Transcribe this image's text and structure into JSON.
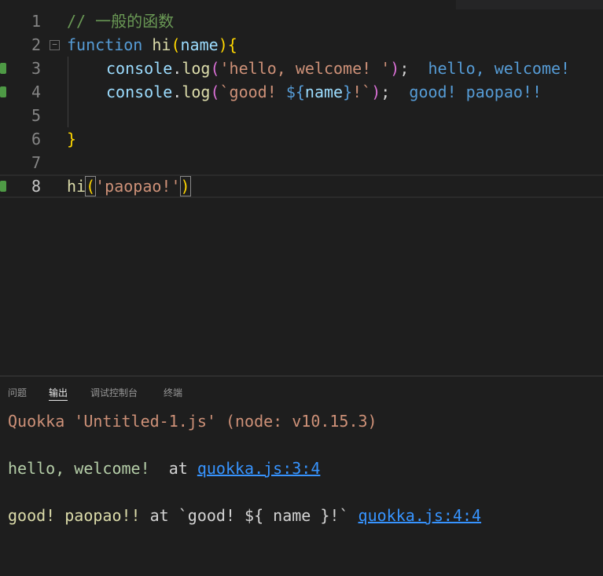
{
  "editor": {
    "lines": [
      {
        "num": "1",
        "comment": "// 一般的函数"
      },
      {
        "num": "2",
        "kw": "function",
        "fn": "hi",
        "open": "(",
        "param": "name",
        "close": ")",
        "brace": "{"
      },
      {
        "num": "3",
        "obj": "console",
        "dot": ".",
        "method": "log",
        "open": "(",
        "str": "'hello, welcome! '",
        "close": ")",
        "semi": ";",
        "inline": "hello, welcome!"
      },
      {
        "num": "4",
        "obj": "console",
        "dot": ".",
        "method": "log",
        "open": "(",
        "str_start": "`good! ",
        "interp_open": "${",
        "var": "name",
        "interp_close": "}",
        "str_end": "!`",
        "close": ")",
        "semi": ";",
        "inline": "good! paopao!!"
      },
      {
        "num": "5"
      },
      {
        "num": "6",
        "brace": "}"
      },
      {
        "num": "7"
      },
      {
        "num": "8",
        "fn": "hi",
        "open": "(",
        "str": "'paopao!'",
        "close": ")"
      }
    ]
  },
  "panel": {
    "tabs": [
      {
        "label": "问题"
      },
      {
        "label": "输出"
      },
      {
        "label": "调试控制台"
      },
      {
        "label": "终端"
      }
    ],
    "active_tab": "输出",
    "output": {
      "header": "Quokka 'Untitled-1.js' (node: v10.15.3)",
      "entry1": {
        "text": "hello, welcome! ",
        "at": " at ",
        "link": "quokka.js:3:4"
      },
      "entry2": {
        "text": "good! paopao!!",
        "at": " at `good! ${ name }!` ",
        "link": "quokka.js:4:4"
      }
    }
  },
  "colors": {
    "background": "#1e1e1e",
    "gutter_modified": "#4e9a45",
    "link": "#3794ff"
  }
}
